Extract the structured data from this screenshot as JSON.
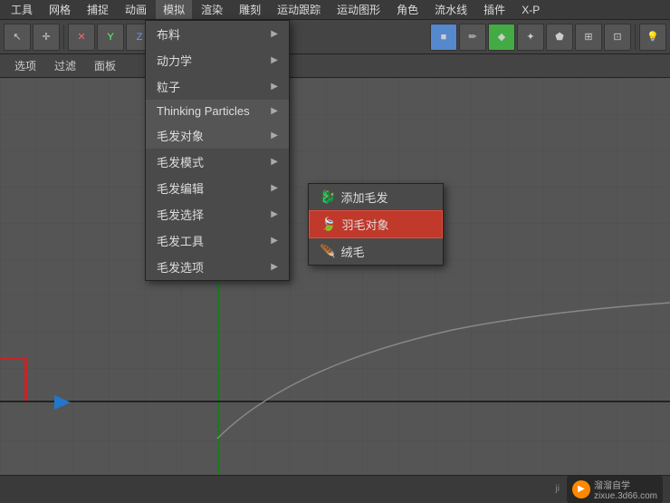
{
  "menubar": {
    "items": [
      {
        "label": "工具",
        "id": "tools"
      },
      {
        "label": "网格",
        "id": "mesh"
      },
      {
        "label": "捕捉",
        "id": "snap"
      },
      {
        "label": "动画",
        "id": "animation"
      },
      {
        "label": "模拟",
        "id": "simulate",
        "active": true
      },
      {
        "label": "渲染",
        "id": "render"
      },
      {
        "label": "雕刻",
        "id": "sculpt"
      },
      {
        "label": "运动跟踪",
        "id": "motion-track"
      },
      {
        "label": "运动图形",
        "id": "mograph"
      },
      {
        "label": "角色",
        "id": "character"
      },
      {
        "label": "流水线",
        "id": "pipeline"
      },
      {
        "label": "插件",
        "id": "plugins"
      },
      {
        "label": "X-P",
        "id": "xp"
      }
    ]
  },
  "simulate_menu": {
    "items": [
      {
        "label": "布料",
        "has_sub": true
      },
      {
        "label": "动力学",
        "has_sub": true
      },
      {
        "label": "粒子",
        "has_sub": true
      },
      {
        "label": "Thinking Particles",
        "has_sub": true,
        "highlighted": true
      },
      {
        "label": "毛发对象",
        "has_sub": true,
        "active": true
      },
      {
        "label": "毛发模式",
        "has_sub": true
      },
      {
        "label": "毛发编辑",
        "has_sub": true
      },
      {
        "label": "毛发选择",
        "has_sub": true
      },
      {
        "label": "毛发工具",
        "has_sub": true
      },
      {
        "label": "毛发选项",
        "has_sub": true
      }
    ]
  },
  "hair_submenu": {
    "items": [
      {
        "label": "添加毛发",
        "icon": "dragon"
      },
      {
        "label": "羽毛对象",
        "icon": "leaf",
        "selected": true
      },
      {
        "label": "绒毛",
        "icon": "feather"
      }
    ]
  },
  "toolbar2": {
    "items": [
      "选项",
      "过滤",
      "面板"
    ]
  },
  "status": {
    "brand_name": "溜溜自学",
    "brand_sub": "zixue.3d66.com",
    "bottom_text": "ji"
  },
  "icons": {
    "arrow_right": "▶",
    "check": "✓",
    "leaf_emoji": "🍃",
    "dragon_emoji": "🐉",
    "feather_emoji": "🪶"
  }
}
